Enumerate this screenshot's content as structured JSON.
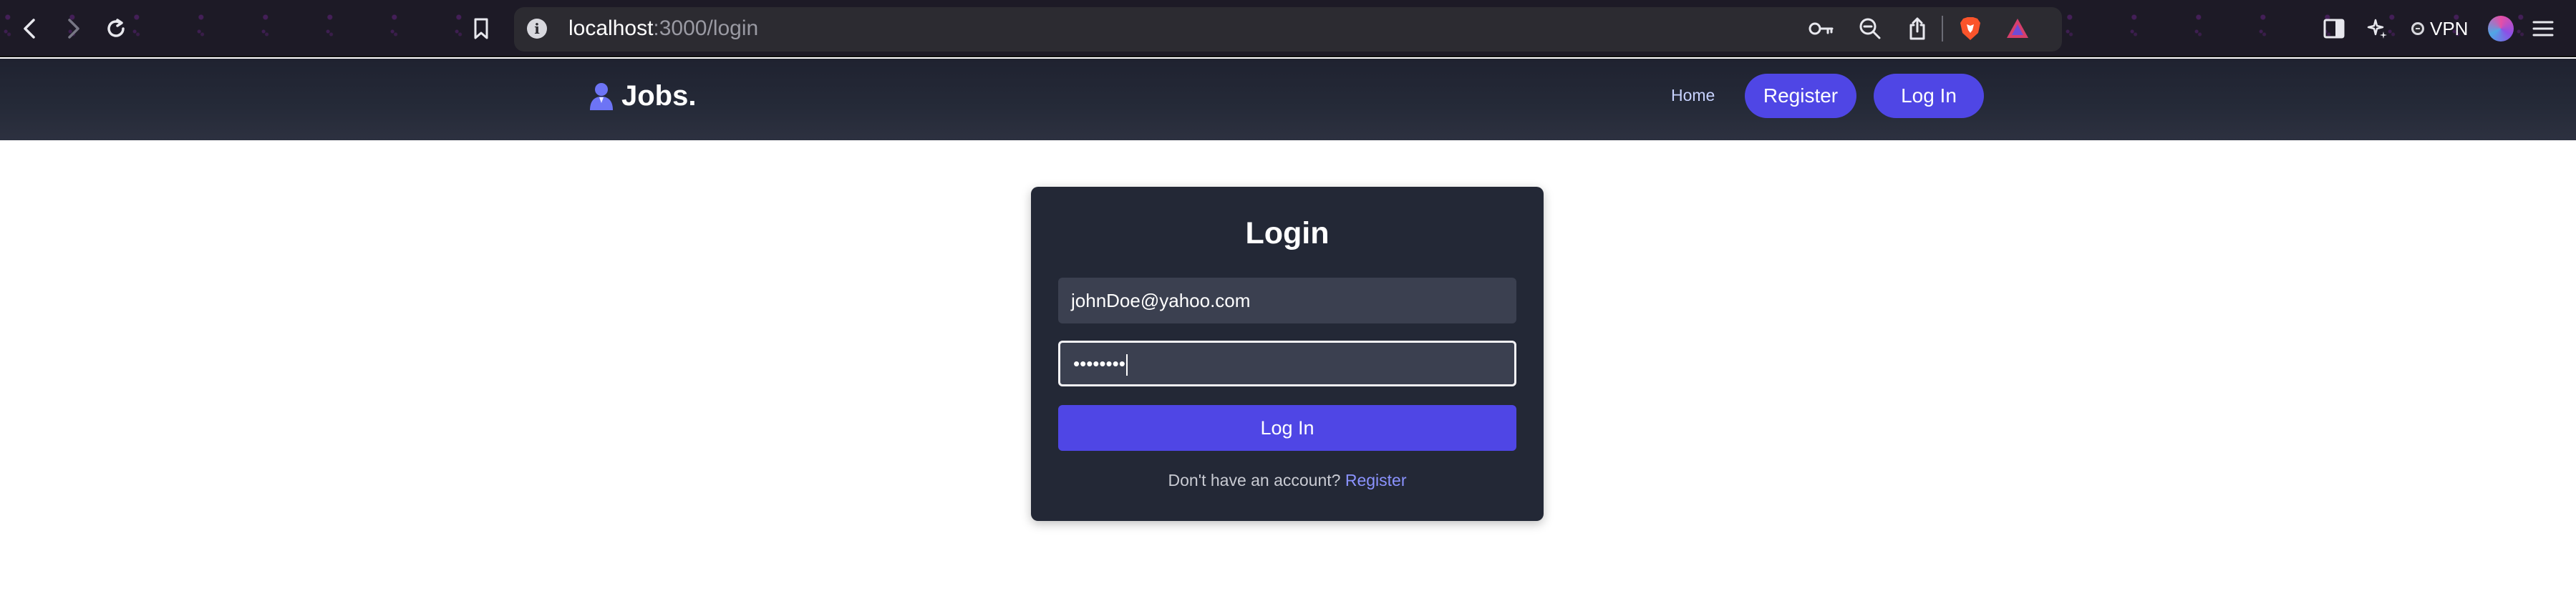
{
  "browser": {
    "url_host": "localhost",
    "url_path": ":3000/login",
    "vpn_label": "VPN",
    "icons": [
      "back-arrow-icon",
      "forward-arrow-icon",
      "reload-icon",
      "bookmark-icon",
      "info-icon",
      "key-icon",
      "zoom-icon",
      "share-icon",
      "brave-shield-icon",
      "brave-rewards-icon",
      "sidebar-icon",
      "leo-ai-icon",
      "vpn-icon",
      "profile-avatar-icon",
      "menu-icon"
    ]
  },
  "navbar": {
    "brand": "Jobs.",
    "home_label": "Home",
    "register_label": "Register",
    "login_label": "Log In",
    "accent_color": "#4f46e5"
  },
  "login": {
    "title": "Login",
    "email_value": "johnDoe@yahoo.com",
    "password_value": "••••••••",
    "submit_label": "Log In",
    "footer_prompt": "Don't have an account?",
    "footer_link": "Register"
  }
}
